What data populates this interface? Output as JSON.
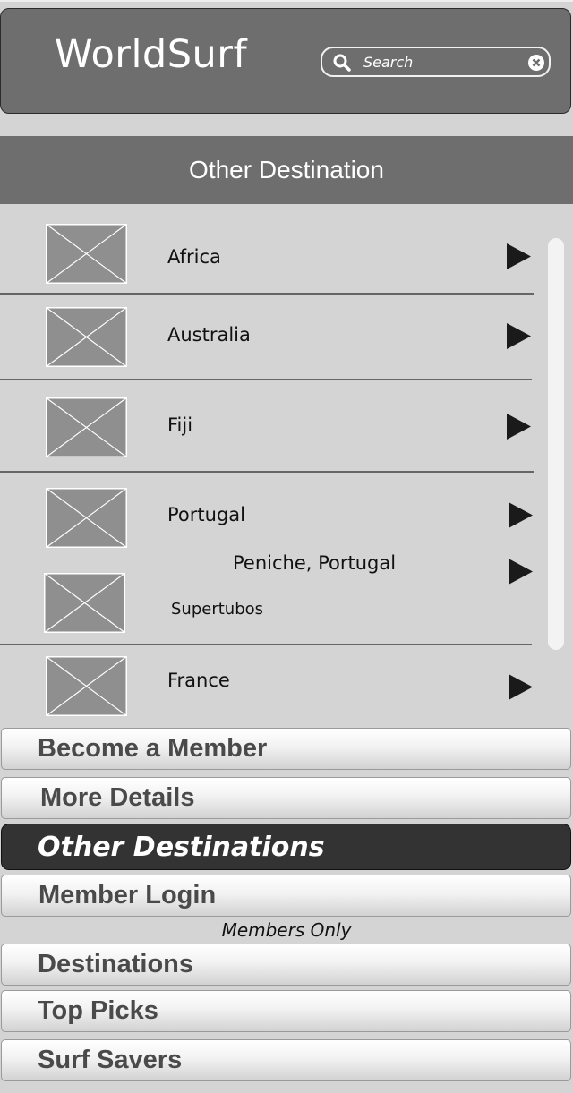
{
  "header": {
    "title": "WorldSurf",
    "search": {
      "placeholder": "Search",
      "value": ""
    }
  },
  "section": {
    "title": "Other Destination"
  },
  "destinations": [
    {
      "label": "Africa"
    },
    {
      "label": "Australia"
    },
    {
      "label": "Fiji"
    },
    {
      "label": "Portugal"
    },
    {
      "label": "Peniche, Portugal"
    },
    {
      "label": "Supertubos"
    },
    {
      "label": "France"
    }
  ],
  "nav": {
    "become_member": "Become a Member",
    "more_details": "More Details",
    "other_destinations": "Other Destinations",
    "member_login": "Member Login",
    "members_only": "Members Only",
    "destinations": "Destinations",
    "top_picks": "Top Picks",
    "surf_savers": "Surf Savers"
  },
  "colors": {
    "header_bg": "#6e6e6e",
    "page_bg": "#d4d4d4",
    "active_nav_bg": "#333333"
  }
}
